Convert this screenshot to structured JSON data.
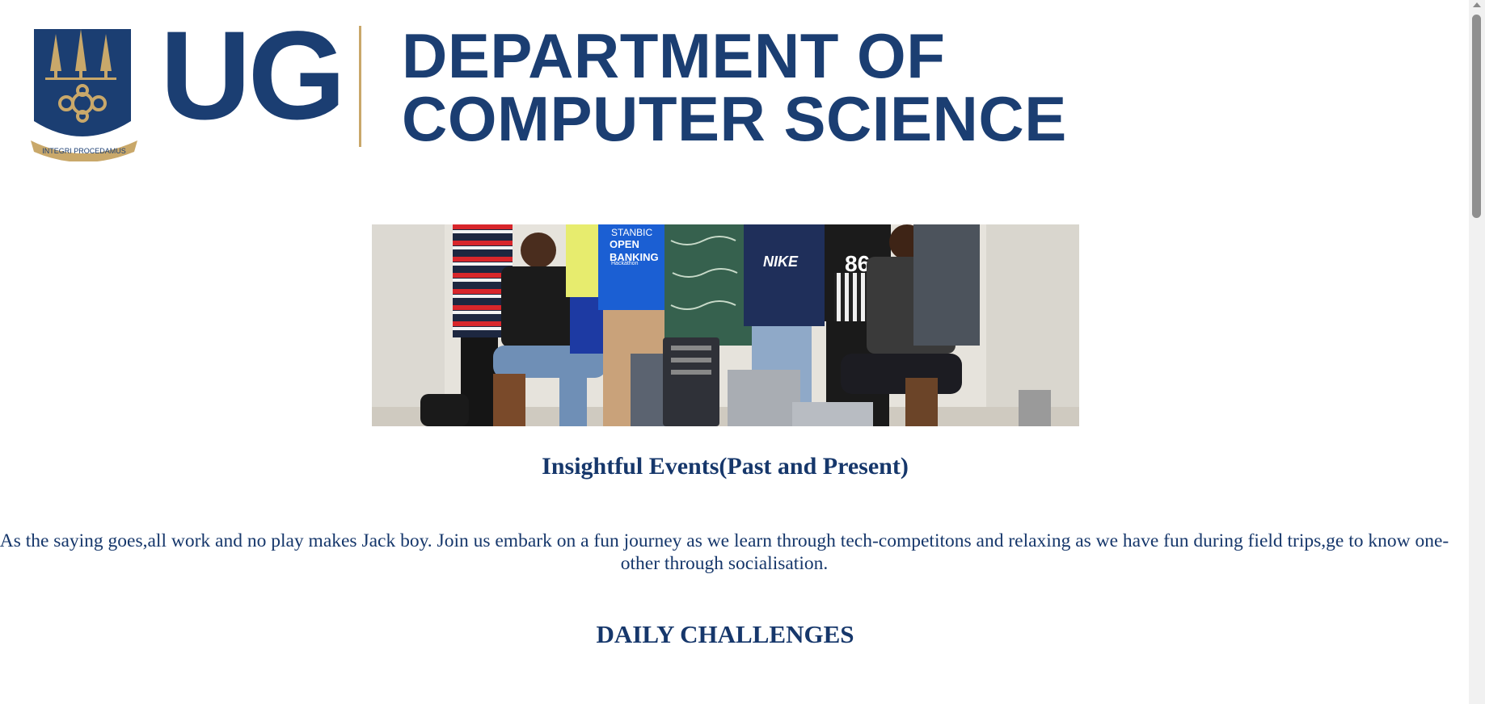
{
  "header": {
    "logo_abbr": "UG",
    "motto": "INTEGRI PROCEDAMUS",
    "department_line1": "DEPARTMENT OF",
    "department_line2": "COMPUTER SCIENCE"
  },
  "hero": {
    "shirt_text_1": "STANBIC",
    "shirt_text_2": "OPEN",
    "shirt_text_3": "BANKING",
    "shirt_text_4": "Hackathon",
    "shirt_nike": "NIKE",
    "shirt_number": "86"
  },
  "events": {
    "heading": "Insightful Events(Past and Present)",
    "intro": "As the saying goes,all work and no play makes Jack boy. Join us embark on a fun journey as we learn through tech-competitons and relaxing as we have fun during field trips,ge to know one-other through socialisation."
  },
  "daily": {
    "heading": "DAILY CHALLENGES"
  },
  "colors": {
    "brand_navy": "#1b3e72",
    "brand_gold": "#c9a86a",
    "text_navy": "#16376b"
  }
}
